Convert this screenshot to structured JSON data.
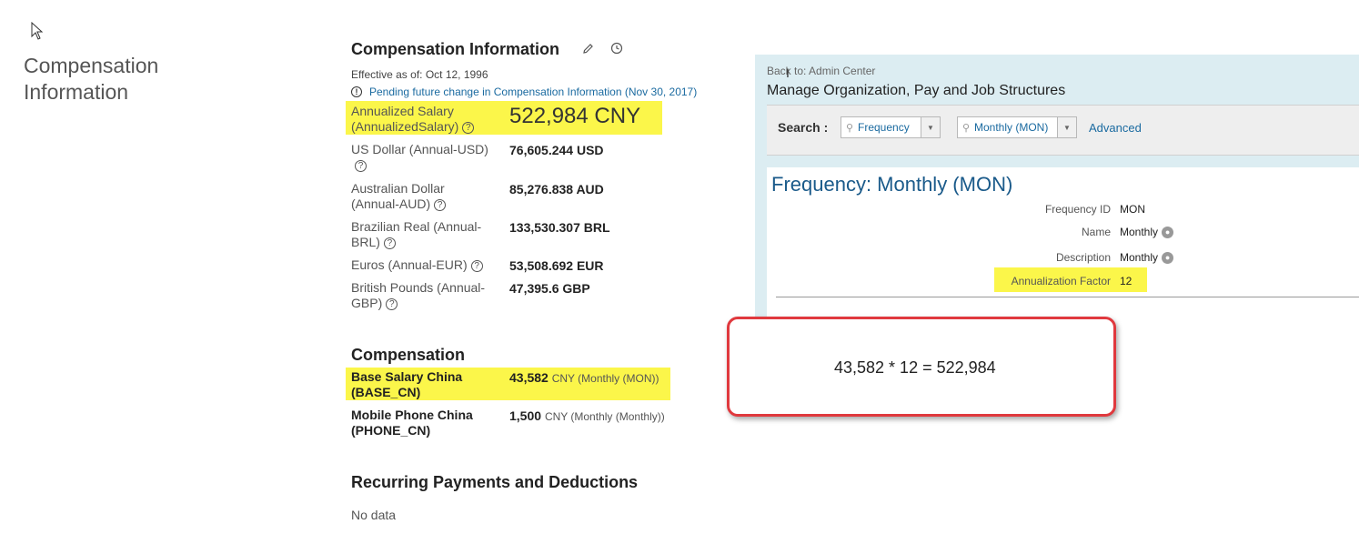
{
  "left": {
    "title_line1": "Compensation",
    "title_line2": "Information"
  },
  "comp_info": {
    "title": "Compensation Information",
    "edit_icon": "pencil-icon",
    "history_icon": "clock-icon",
    "effective": "Effective as of: Oct 12, 1996",
    "pending": "Pending future change in Compensation Information (Nov 30, 2017)",
    "rows": [
      {
        "label_line1": "Annualized Salary",
        "label_line2": "(AnnualizedSalary)",
        "value": "522,984 CNY"
      },
      {
        "label_line1": "US Dollar (Annual-USD)",
        "label_line2": "",
        "value": "76,605.244 USD"
      },
      {
        "label_line1": "Australian Dollar",
        "label_line2": "(Annual-AUD)",
        "value": "85,276.838 AUD"
      },
      {
        "label_line1": "Brazilian Real (Annual-",
        "label_line2": "BRL)",
        "value": "133,530.307 BRL"
      },
      {
        "label_line1": "Euros (Annual-EUR)",
        "label_line2": "",
        "value": "53,508.692 EUR"
      },
      {
        "label_line1": "British Pounds (Annual-",
        "label_line2": "GBP)",
        "value": "47,395.6 GBP"
      }
    ]
  },
  "compensation": {
    "title": "Compensation",
    "rows": [
      {
        "label_line1": "Base Salary China",
        "label_line2": "(BASE_CN)",
        "amount": "43,582",
        "detail": "CNY (Monthly (MON))"
      },
      {
        "label_line1": "Mobile Phone China",
        "label_line2": "(PHONE_CN)",
        "amount": "1,500",
        "detail": "CNY (Monthly (Monthly))"
      }
    ]
  },
  "recurring": {
    "title": "Recurring Payments and Deductions",
    "empty": "No data"
  },
  "admin": {
    "back": "Back to: Admin Center",
    "manage": "Manage Organization, Pay and Job Structures",
    "search_label": "Search :",
    "search_type": "Frequency",
    "search_value": "Monthly (MON)",
    "advanced": "Advanced",
    "heading": "Frequency: Monthly (MON)",
    "fields": [
      {
        "label": "Frequency ID",
        "value": "MON"
      },
      {
        "label": "Name",
        "value": "Monthly"
      },
      {
        "label": "Description",
        "value": "Monthly"
      },
      {
        "label": "Annualization Factor",
        "value": "12"
      }
    ]
  },
  "callout": {
    "formula": "43,582 * 12 = 522,984"
  },
  "colors": {
    "highlight": "#fbf64a",
    "link": "#1a6aa0",
    "callout_border": "#e0393e",
    "panel_bg": "#dcedf2"
  }
}
